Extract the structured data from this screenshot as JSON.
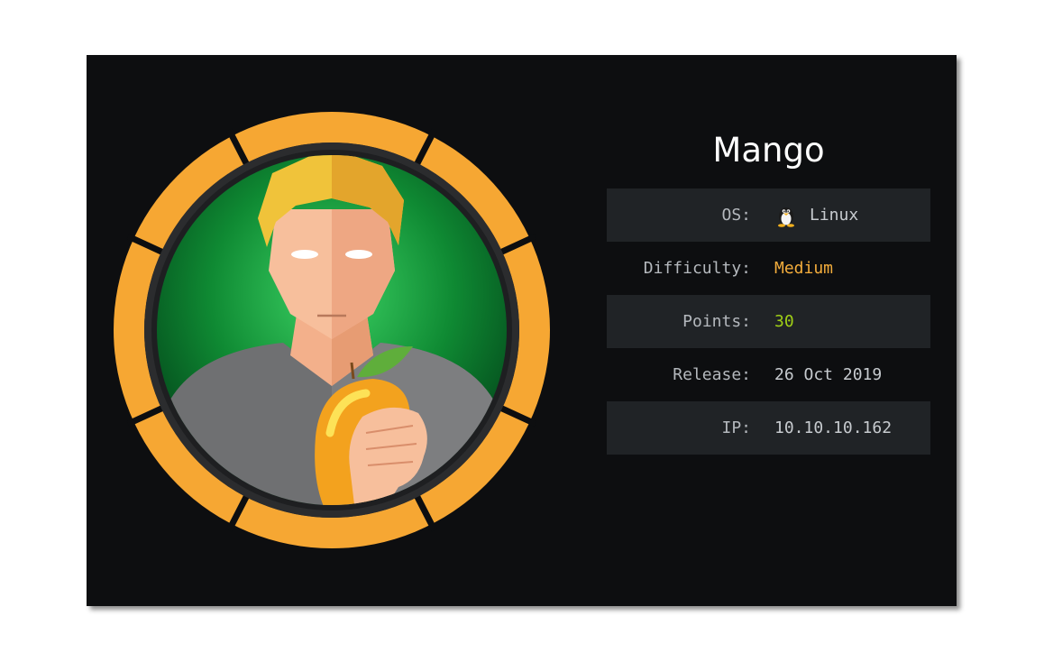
{
  "machine": {
    "name": "Mango",
    "avatar_icon": "mango-avatar-icon"
  },
  "details": {
    "os_label": "OS:",
    "os_value": "Linux",
    "os_icon": "linux-tux-icon",
    "difficulty_label": "Difficulty:",
    "difficulty_value": "Medium",
    "points_label": "Points:",
    "points_value": "30",
    "release_label": "Release:",
    "release_value": "26 Oct 2019",
    "ip_label": "IP:",
    "ip_value": "10.10.10.162"
  },
  "colors": {
    "card_background": "#0d0e10",
    "row_shade": "#202326",
    "difficulty_medium": "#f4ad3c",
    "points": "#9fcf16",
    "ring_orange": "#f6a733",
    "avatar_green": "#138a34"
  }
}
